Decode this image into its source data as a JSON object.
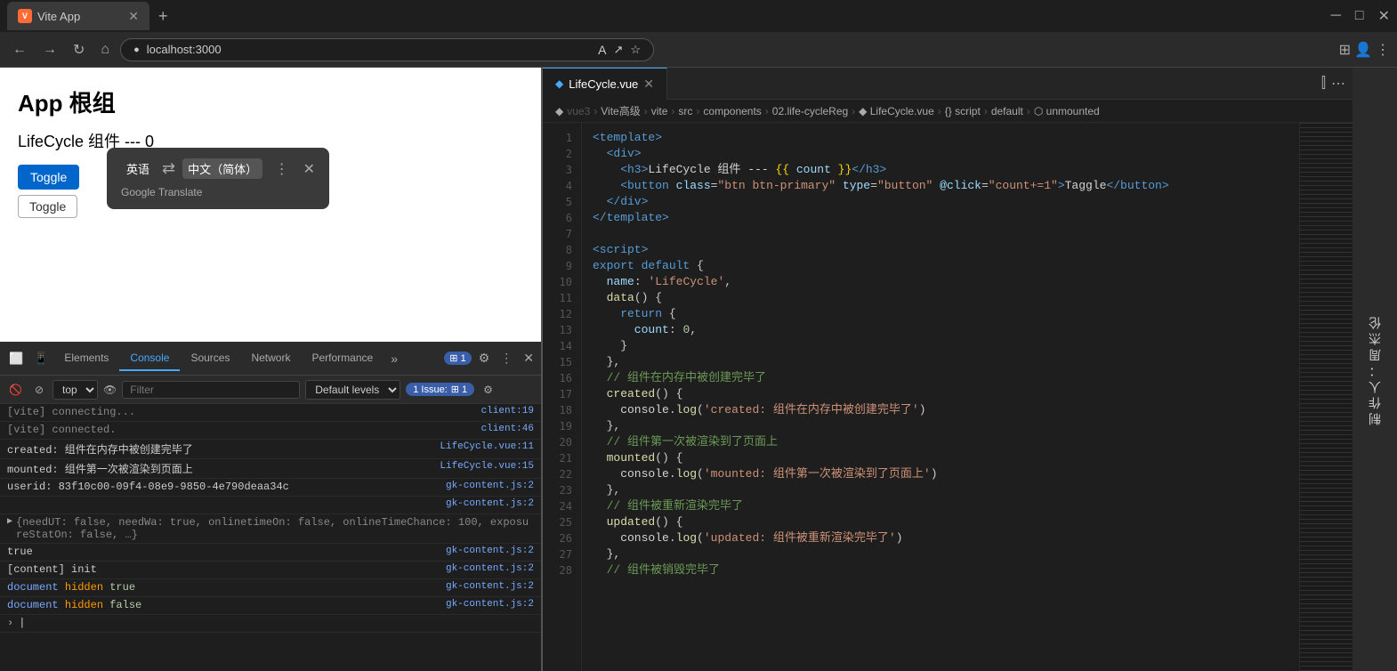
{
  "browser": {
    "tab_label": "Vite App",
    "url": "localhost:3000",
    "new_tab_label": "+",
    "translate": {
      "from_lang": "英语",
      "to_lang": "中文（简体）",
      "footer_text": "Google Translate"
    }
  },
  "page": {
    "app_title": "App 根组",
    "lifecycle_title": "LifeCycle 组件 --- 0",
    "btn1": "Toggle",
    "btn2": "Toggle"
  },
  "devtools": {
    "tabs": [
      "Elements",
      "Console",
      "Sources",
      "Network",
      "Performance",
      "»"
    ],
    "active_tab": "Console",
    "badge_count": "1",
    "context": "top",
    "filter_placeholder": "Filter",
    "levels": "Default levels",
    "issue_label": "1 Issue:",
    "console_rows": [
      {
        "msg": "[vite] connecting...",
        "source": "client:19",
        "type": "normal"
      },
      {
        "msg": "[vite] connected.",
        "source": "client:46",
        "type": "normal"
      },
      {
        "msg": "created: 组件在内存中被创建完毕了",
        "source": "LifeCycle.vue:11",
        "type": "normal"
      },
      {
        "msg": "mounted: 组件第一次被渲染到页面上",
        "source": "LifeCycle.vue:15",
        "type": "normal"
      },
      {
        "msg": "userid: 83f10c00-09f4-08e9-9850-4e790deaa34c",
        "source": "gk-content.js:2",
        "type": "normal"
      },
      {
        "msg": "",
        "source": "gk-content.js:2",
        "type": "normal"
      },
      {
        "msg": "  {needUT: false, needWa: true, onlinetimeOn: false, onlineTimeChance: 100, exposureStatOn: false, …}",
        "source": "",
        "type": "expand"
      },
      {
        "msg": "true",
        "source": "gk-content.js:2",
        "type": "normal"
      },
      {
        "msg": "[content] init",
        "source": "gk-content.js:2",
        "type": "normal"
      },
      {
        "msg": "document hidden true",
        "source": "gk-content.js:2",
        "type": "normal"
      },
      {
        "msg": "document hidden false",
        "source": "gk-content.js:2",
        "type": "normal"
      }
    ]
  },
  "editor": {
    "tab_label": "LifeCycle.vue",
    "breadcrumb": [
      "vue3",
      "Vite高级",
      "vite",
      "src",
      "components",
      "02.life-cycleReg",
      "LifeCycle.vue",
      "{} script",
      "default",
      "unmounted"
    ],
    "lines": [
      {
        "num": 1,
        "code": "<template>",
        "type": "tag"
      },
      {
        "num": 2,
        "code": "  <div>",
        "type": "tag"
      },
      {
        "num": 3,
        "code": "    <h3>LifeCycle 组件 --- {{ count }}</h3>",
        "type": "mixed"
      },
      {
        "num": 4,
        "code": "    <button class=\"btn btn-primary\" type=\"button\" @click=\"count+=1\">Taggle</button>",
        "type": "mixed"
      },
      {
        "num": 5,
        "code": "  </div>",
        "type": "tag"
      },
      {
        "num": 6,
        "code": "</template>",
        "type": "tag"
      },
      {
        "num": 7,
        "code": "",
        "type": "empty"
      },
      {
        "num": 8,
        "code": "<script>",
        "type": "tag"
      },
      {
        "num": 9,
        "code": "export default {",
        "type": "code"
      },
      {
        "num": 10,
        "code": "  name: 'LifeCycle',",
        "type": "code"
      },
      {
        "num": 11,
        "code": "  data() {",
        "type": "code"
      },
      {
        "num": 12,
        "code": "    return {",
        "type": "code"
      },
      {
        "num": 13,
        "code": "      count: 0,",
        "type": "code"
      },
      {
        "num": 14,
        "code": "    }",
        "type": "code"
      },
      {
        "num": 15,
        "code": "  },",
        "type": "code"
      },
      {
        "num": 16,
        "code": "  // 组件在内存中被创建完毕了",
        "type": "comment"
      },
      {
        "num": 17,
        "code": "  created() {",
        "type": "code"
      },
      {
        "num": 18,
        "code": "    console.log('created: 组件在内存中被创建完毕了')",
        "type": "code"
      },
      {
        "num": 19,
        "code": "  },",
        "type": "code"
      },
      {
        "num": 20,
        "code": "  // 组件第一次被渲染到了页面上",
        "type": "comment"
      },
      {
        "num": 21,
        "code": "  mounted() {",
        "type": "code"
      },
      {
        "num": 22,
        "code": "    console.log('mounted: 组件第一次被渲染到了页面上')",
        "type": "code"
      },
      {
        "num": 23,
        "code": "  },",
        "type": "code"
      },
      {
        "num": 24,
        "code": "  // 组件被重新渲染完毕了",
        "type": "comment"
      },
      {
        "num": 25,
        "code": "  updated() {",
        "type": "code"
      },
      {
        "num": 26,
        "code": "    console.log('updated: 组件被重新渲染完毕了')",
        "type": "code"
      },
      {
        "num": 27,
        "code": "  },",
        "type": "code"
      },
      {
        "num": 28,
        "code": "  // 组件被销毁完毕了",
        "type": "comment"
      }
    ],
    "right_label": "制作人：周杰伦"
  }
}
